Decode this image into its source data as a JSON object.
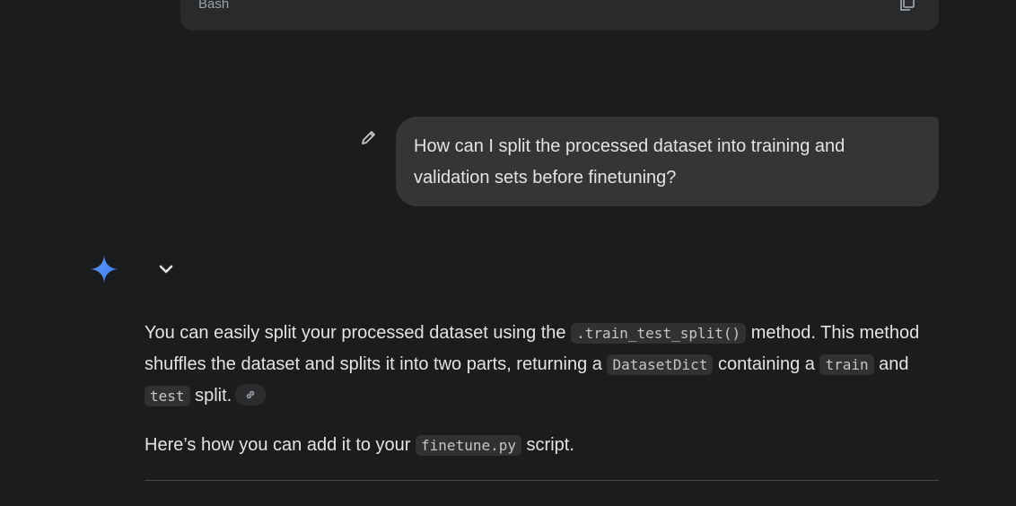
{
  "code_block": {
    "language": "Bash"
  },
  "user_message": {
    "text": "How can I split the processed dataset into training and validation sets before finetuning?"
  },
  "response": {
    "p1": {
      "t1": "You can easily split your processed dataset using the ",
      "code1": ".train_test_split()",
      "t2": " method. This method shuffles the dataset and splits it into two parts, returning a ",
      "code2": "DatasetDict",
      "t3": " containing a ",
      "code3": "train",
      "t4": " and ",
      "code4": "test",
      "t5": " split."
    },
    "p2": {
      "t1": "Here’s how you can add it to your ",
      "code1": "finetune.py",
      "t2": " script."
    }
  },
  "colors": {
    "background": "#1b1c1d",
    "bubble": "#333537",
    "spark": "#4a8cf7"
  },
  "icons": [
    "copy-icon",
    "edit-icon",
    "gemini-spark-icon",
    "chevron-down-icon",
    "link-icon"
  ]
}
